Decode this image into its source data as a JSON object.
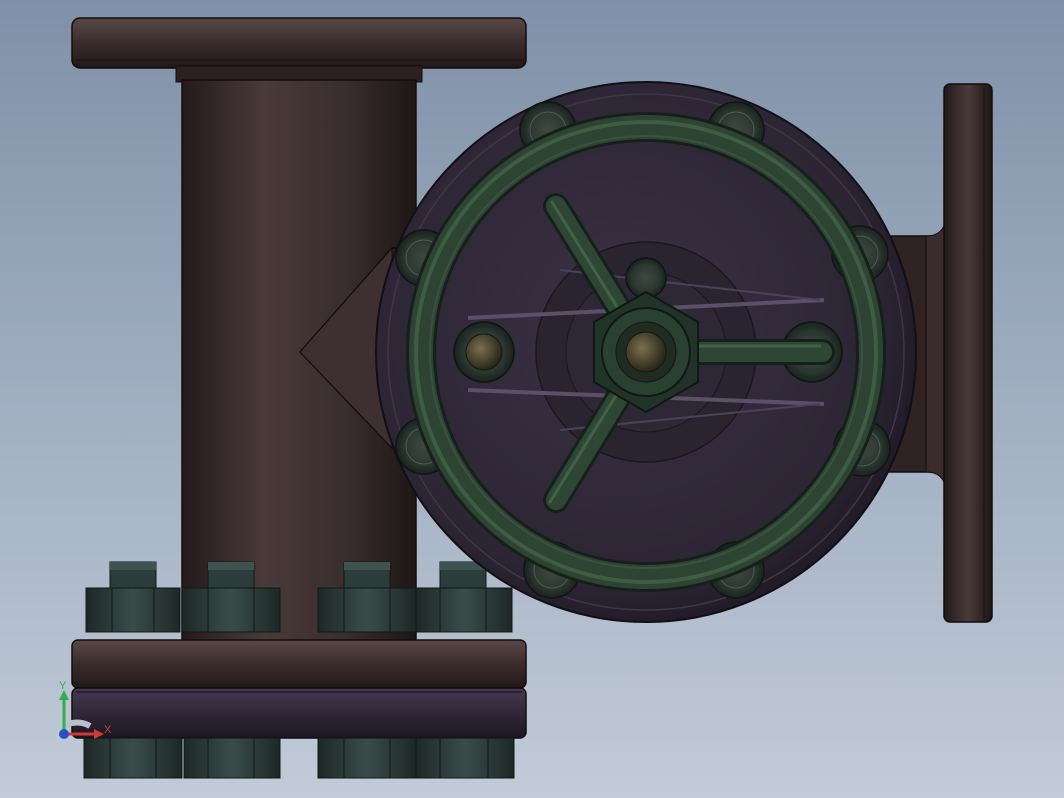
{
  "viewport": {
    "background_top": "#7f91a8",
    "background_bottom": "#c2cbd8"
  },
  "model": {
    "body_color": "#3b2c2c",
    "bonnet_color": "#312a38",
    "handwheel_color": "#2b4030",
    "nut_color": "#2b3a38"
  },
  "triad": {
    "y_label": "Y",
    "x_label": "X",
    "y_color": "#2fb04a",
    "x_color": "#d23a3a",
    "origin_color": "#2a50c8"
  }
}
